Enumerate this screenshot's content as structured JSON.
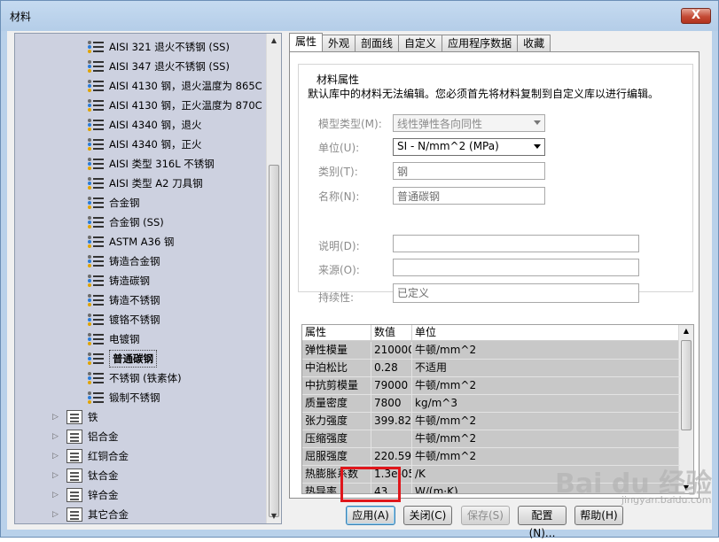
{
  "window": {
    "title": "材料",
    "close_glyph": "X"
  },
  "tree": {
    "materials": [
      "AISI 321 退火不锈钢 (SS)",
      "AISI 347 退火不锈钢 (SS)",
      "AISI 4130 钢，退火温度为 865C",
      "AISI 4130 钢，正火温度为 870C",
      "AISI 4340 钢，退火",
      "AISI 4340 钢，正火",
      "AISI 类型 316L 不锈钢",
      "AISI 类型 A2 刀具钢",
      "合金钢",
      "合金钢 (SS)",
      "ASTM A36 钢",
      "铸造合金钢",
      "铸造碳钢",
      "铸造不锈钢",
      "镀铬不锈钢",
      "电镀钢",
      "普通碳钢",
      "不锈钢 (铁素体)",
      "锻制不锈钢"
    ],
    "selected_index": 16,
    "folders": [
      "铁",
      "铝合金",
      "红铜合金",
      "钛合金",
      "锌合金",
      "其它合金"
    ]
  },
  "tabs": [
    "属性",
    "外观",
    "剖面线",
    "自定义",
    "应用程序数据",
    "收藏"
  ],
  "active_tab": 0,
  "properties": {
    "group_title": "材料属性",
    "notice": "默认库中的材料无法编辑。您必须首先将材料复制到自定义库以进行编辑。",
    "model_type_label": "模型类型(M):",
    "model_type_value": "线性弹性各向同性",
    "units_label": "单位(U):",
    "units_value": "SI - N/mm^2 (MPa)",
    "category_label": "类别(T):",
    "category_value": "钢",
    "name_label": "名称(N):",
    "name_value": "普通碳钢",
    "description_label": "说明(D):",
    "description_value": "",
    "source_label": "来源(O):",
    "source_value": "",
    "sustainability_label": "持续性:",
    "sustainability_value": "已定义"
  },
  "prop_table": {
    "headers": [
      "属性",
      "数值",
      "单位"
    ],
    "rows": [
      [
        "弹性模量",
        "210000",
        "牛顿/mm^2"
      ],
      [
        "中泊松比",
        "0.28",
        "不适用"
      ],
      [
        "中抗剪模量",
        "79000",
        "牛顿/mm^2"
      ],
      [
        "质量密度",
        "7800",
        "kg/m^3"
      ],
      [
        "张力强度",
        "399.826",
        "牛顿/mm^2"
      ],
      [
        "压缩强度",
        "",
        "牛顿/mm^2"
      ],
      [
        "屈服强度",
        "220.594",
        "牛顿/mm^2"
      ],
      [
        "热膨胀系数",
        "1.3e-05",
        "/K"
      ],
      [
        "热导率",
        "43",
        "W/(m·K)"
      ]
    ]
  },
  "buttons": {
    "apply": "应用(A)",
    "close": "关闭(C)",
    "save": "保存(S)",
    "config": "配置(N)...",
    "help": "帮助(H)"
  },
  "watermark": {
    "main": "Bai du 经验",
    "sub": "jingyan.baidu.com"
  }
}
